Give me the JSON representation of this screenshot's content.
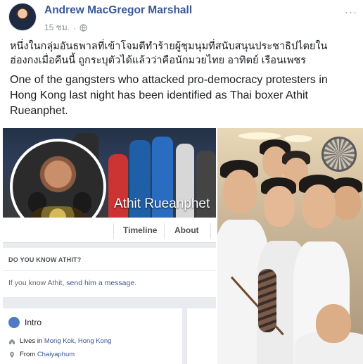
{
  "post": {
    "author": "Andrew MacGregor Marshall",
    "time": "15 ชม.",
    "separator": "·",
    "more": "···",
    "text_thai": "หนึ่งในกลุ่มอันธพาลที่เข้าโจมตีทำร้ายผู้ชุมนุมที่สนับสนุนประชาธิปไตยในฮ่องกงเมื่อคืนนี้ ถูกระบุตัวได้แล้วว่าคือนักมวยไทย อาทิตย์ เรือนเพชร",
    "text_english": "One of the gangsters who attacked pro-democracy protesters in Hong Kong last night has been identified as Thai boxer Athit Rueanphet."
  },
  "profile_screenshot": {
    "name": "Athit Rueanphet",
    "tabs": [
      "Timeline",
      "About"
    ],
    "know_title": "DO YOU KNOW ATHIT?",
    "know_text_prefix": "If you know Athit, ",
    "know_link": "send him a message",
    "know_text_suffix": ".",
    "intro_title": "Intro",
    "lives_prefix": "Lives in ",
    "lives_place": "Mong Kok, Hong Kong",
    "from_prefix": "From ",
    "from_place": "Chaiyaphum"
  },
  "colors": {
    "link": "#385898",
    "meta": "#90949c",
    "text": "#1c1e21",
    "feed_bg": "#e9ebee"
  },
  "icons": {
    "privacy": "globe-icon",
    "more": "more-options-icon",
    "intro": "intro-globe-icon",
    "lives": "home-icon",
    "from": "pin-icon"
  }
}
